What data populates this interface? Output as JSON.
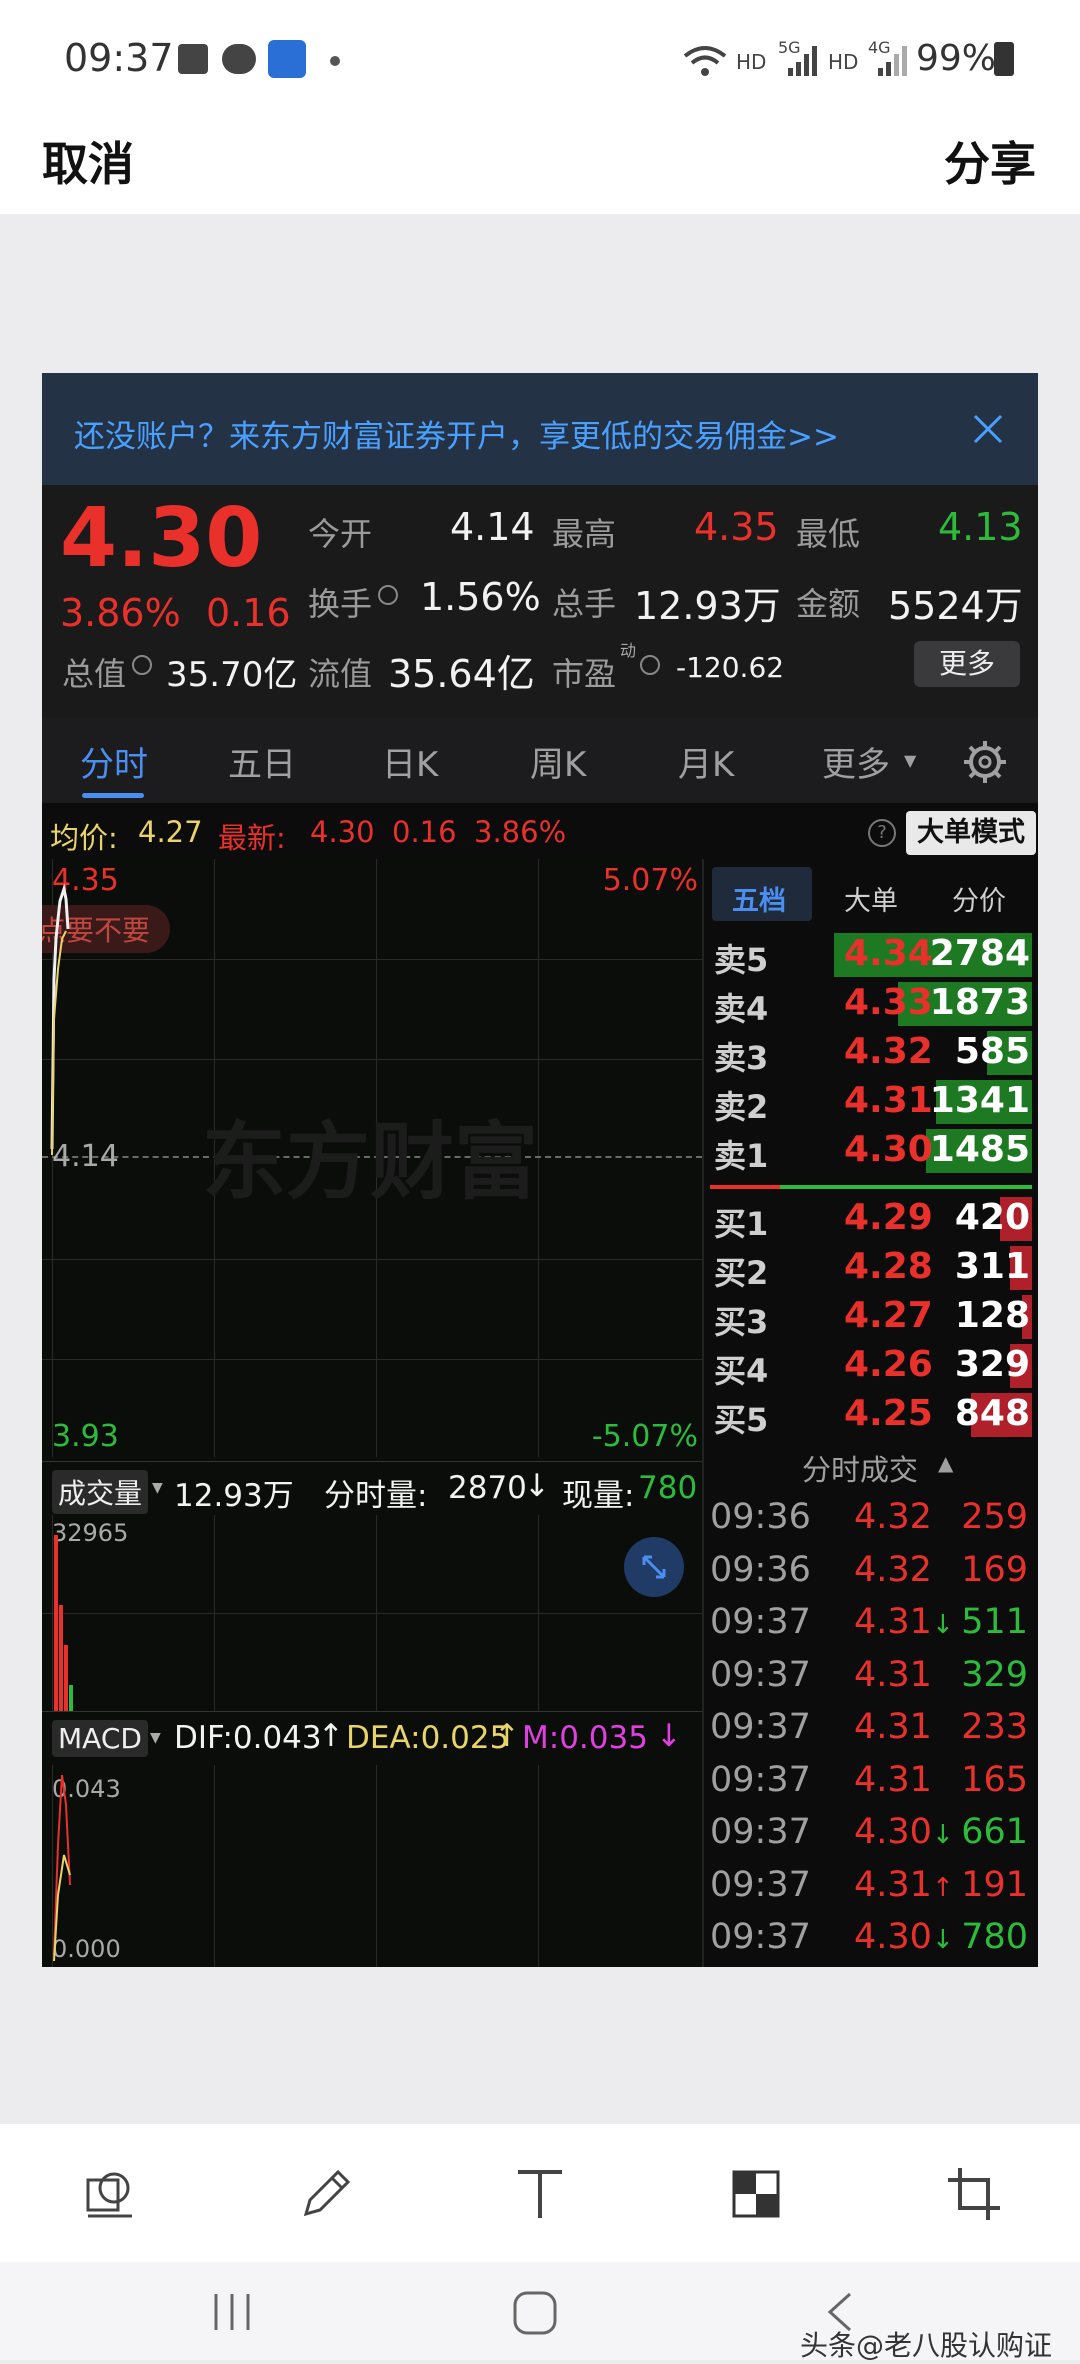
{
  "status_bar": {
    "time": "09:37",
    "battery": "99%",
    "hd1": "HD",
    "hd2": "HD",
    "net1": "5G",
    "net2": "4G"
  },
  "top_bar": {
    "cancel": "取消",
    "share": "分享"
  },
  "screenshot": {
    "banner": {
      "text": "还没账户？来东方财富证券开户，享更低的交易佣金>>",
      "close_icon": "close-icon"
    },
    "quote": {
      "price": "4.30",
      "change_pct": "3.86%",
      "change": "0.16",
      "open_label": "今开",
      "open": "4.14",
      "high_label": "最高",
      "high": "4.35",
      "low_label": "最低",
      "low": "4.13",
      "turnover_label": "换手",
      "turnover": "1.56%",
      "volume_label": "总手",
      "volume": "12.93万",
      "amount_label": "金额",
      "amount": "5524万",
      "mktcap_label": "总值",
      "mktcap": "35.70亿",
      "float_label": "流值",
      "float": "35.64亿",
      "pe_label": "市盈",
      "pe_sup": "动",
      "pe": "-120.62",
      "more_button": "更多"
    },
    "tabs": [
      "分时",
      "五日",
      "日K",
      "周K",
      "月K",
      "更多"
    ],
    "active_tab": "分时",
    "info_line": {
      "avg_label": "均价:",
      "avg": "4.27",
      "latest_label": "最新:",
      "latest": "4.30",
      "chg": "0.16",
      "pct": "3.86%",
      "big_order_button": "大单模式"
    },
    "price_chart": {
      "top_price": "4.35",
      "top_pct": "5.07%",
      "mid_price": "4.14",
      "bottom_price": "3.93",
      "bottom_pct": "-5.07%",
      "watermark": "东方财富",
      "overlay_pill": "点要不要"
    },
    "volume_chart": {
      "select": "成交量",
      "total": "12.93万",
      "minute_label": "分时量:",
      "minute_value": "2870",
      "now_label": "现量:",
      "now_value": "780",
      "max": "32965"
    },
    "macd": {
      "select": "MACD",
      "dif": "DIF:0.043",
      "dea": "DEA:0.025",
      "m": "M:0.035",
      "top": "0.043",
      "bottom": "0.000"
    },
    "order_book": {
      "tabs": [
        "五档",
        "大单",
        "分价"
      ],
      "asks": [
        {
          "label": "卖5",
          "price": "4.34",
          "vol": "2784",
          "fill": 0.62
        },
        {
          "label": "卖4",
          "price": "4.33",
          "vol": "1873",
          "fill": 0.42
        },
        {
          "label": "卖3",
          "price": "4.32",
          "vol": "585",
          "fill": 0.14
        },
        {
          "label": "卖2",
          "price": "4.31",
          "vol": "1341",
          "fill": 0.3
        },
        {
          "label": "卖1",
          "price": "4.30",
          "vol": "1485",
          "fill": 0.33
        }
      ],
      "bids": [
        {
          "label": "买1",
          "price": "4.29",
          "vol": "420",
          "fill": 0.1
        },
        {
          "label": "买2",
          "price": "4.28",
          "vol": "311",
          "fill": 0.07
        },
        {
          "label": "买3",
          "price": "4.27",
          "vol": "128",
          "fill": 0.03
        },
        {
          "label": "买4",
          "price": "4.26",
          "vol": "329",
          "fill": 0.07
        },
        {
          "label": "买5",
          "price": "4.25",
          "vol": "848",
          "fill": 0.19
        }
      ]
    },
    "trades": {
      "title": "分时成交",
      "rows": [
        {
          "time": "09:36",
          "price": "4.32",
          "vol": "259",
          "color": "red",
          "arrow": ""
        },
        {
          "time": "09:36",
          "price": "4.32",
          "vol": "169",
          "color": "red",
          "arrow": ""
        },
        {
          "time": "09:37",
          "price": "4.31",
          "vol": "511",
          "color": "green",
          "arrow": "↓"
        },
        {
          "time": "09:37",
          "price": "4.31",
          "vol": "329",
          "color": "green",
          "arrow": ""
        },
        {
          "time": "09:37",
          "price": "4.31",
          "vol": "233",
          "color": "red",
          "arrow": ""
        },
        {
          "time": "09:37",
          "price": "4.31",
          "vol": "165",
          "color": "red",
          "arrow": ""
        },
        {
          "time": "09:37",
          "price": "4.30",
          "vol": "661",
          "color": "green",
          "arrow": "↓"
        },
        {
          "time": "09:37",
          "price": "4.31",
          "vol": "191",
          "color": "red",
          "arrow": "↑"
        },
        {
          "time": "09:37",
          "price": "4.30",
          "vol": "780",
          "color": "green",
          "arrow": "↓"
        }
      ]
    }
  },
  "editor_tools": [
    "stickers-icon",
    "pen-icon",
    "text-icon",
    "mosaic-icon",
    "crop-icon"
  ],
  "nav_bar": [
    "recent-apps-icon",
    "home-icon",
    "back-icon"
  ],
  "watermark": "头条@老八股认购证"
}
